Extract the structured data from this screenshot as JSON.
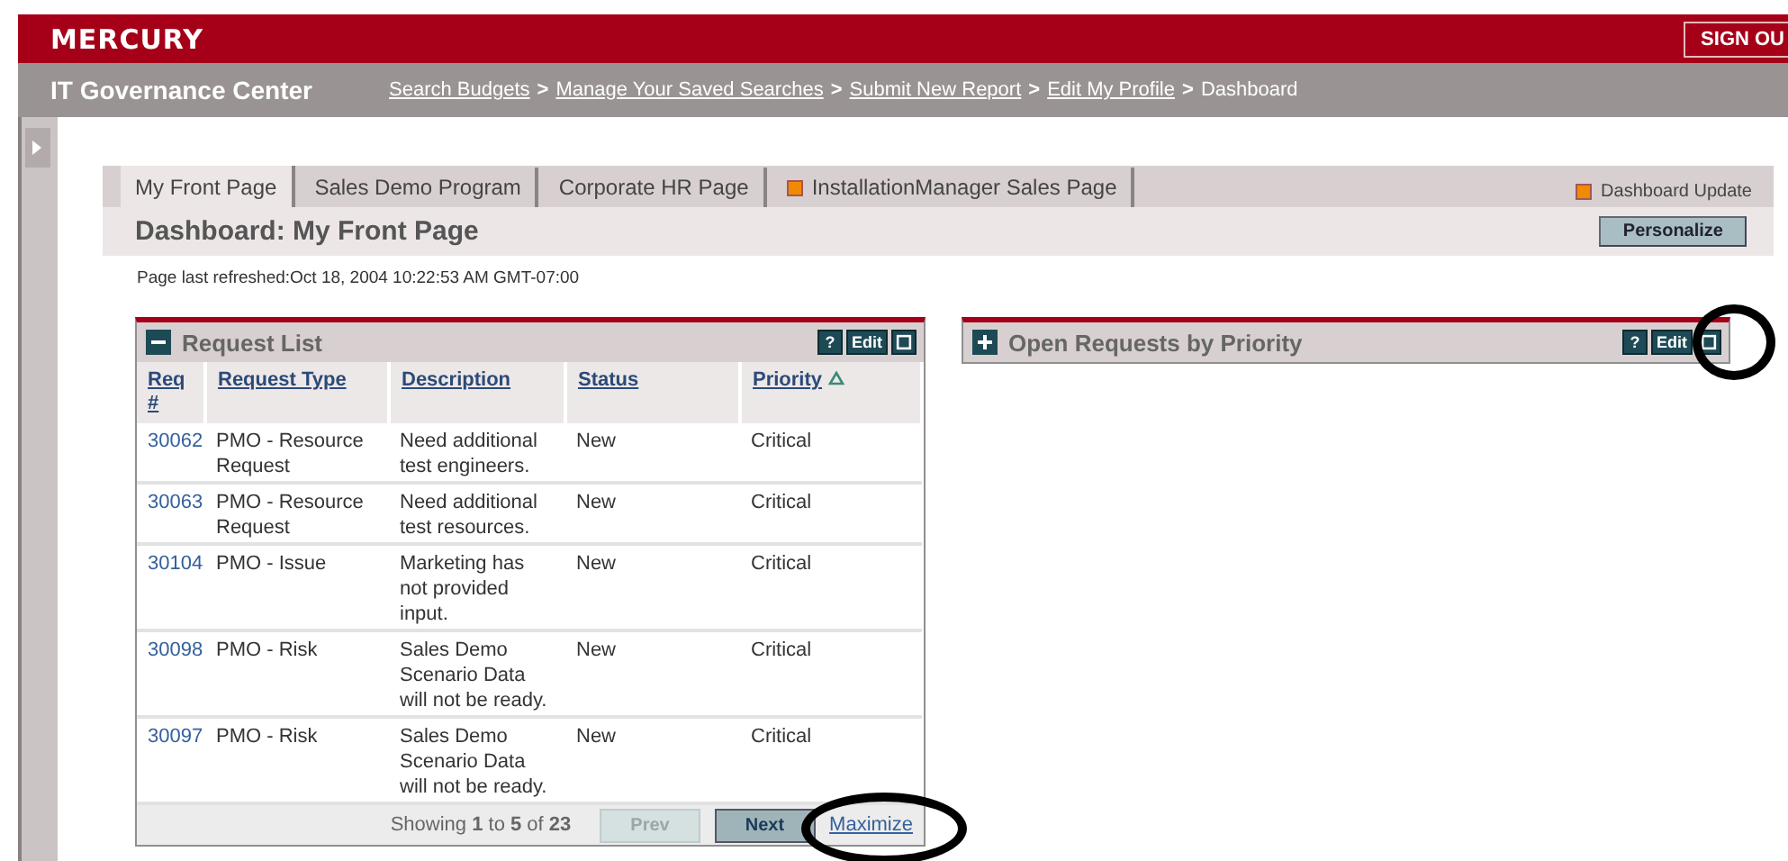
{
  "header": {
    "logo": "MERCURY",
    "sign_out": "SIGN OU"
  },
  "nav": {
    "title": "IT Governance Center",
    "separator": ">",
    "breadcrumbs": [
      {
        "label": "Search Budgets",
        "link": true
      },
      {
        "label": "Manage Your Saved Searches",
        "link": true
      },
      {
        "label": "Submit New Report",
        "link": true
      },
      {
        "label": "Edit My Profile",
        "link": true
      },
      {
        "label": "Dashboard",
        "link": false
      }
    ]
  },
  "sidebar": {
    "collapsed": true
  },
  "tabs": [
    {
      "label": "My Front Page",
      "selected": true,
      "updated": false
    },
    {
      "label": "Sales Demo Program",
      "selected": false,
      "updated": false
    },
    {
      "label": "Corporate HR Page",
      "selected": false,
      "updated": false
    },
    {
      "label": "InstallationManager Sales Page",
      "selected": false,
      "updated": true
    }
  ],
  "legend": {
    "label": "Dashboard Update"
  },
  "page_title": "Dashboard: My Front Page",
  "personalize": "Personalize",
  "refreshed": "Page last refreshed:Oct 18, 2004 10:22:53 AM GMT-07:00",
  "request_list": {
    "title": "Request List",
    "expanded": true,
    "help": "?",
    "edit": "Edit",
    "columns": [
      {
        "label": "Req #",
        "sorted": false
      },
      {
        "label": "Request Type",
        "sorted": false
      },
      {
        "label": "Description",
        "sorted": false
      },
      {
        "label": "Status",
        "sorted": false
      },
      {
        "label": "Priority",
        "sorted": true
      }
    ],
    "rows": [
      [
        "30062",
        "PMO - Resource Request",
        "Need additional test engineers.",
        "New",
        "Critical"
      ],
      [
        "30063",
        "PMO - Resource Request",
        "Need additional test resources.",
        "New",
        "Critical"
      ],
      [
        "30104",
        "PMO - Issue",
        "Marketing has not provided input.",
        "New",
        "Critical"
      ],
      [
        "30098",
        "PMO - Risk",
        "Sales Demo Scenario Data will not be ready.",
        "New",
        "Critical"
      ],
      [
        "30097",
        "PMO - Risk",
        "Sales Demo Scenario Data will not be ready.",
        "New",
        "Critical"
      ]
    ],
    "summary": "Showing **1** to **5** of **23**",
    "prev": {
      "label": "Prev",
      "disabled": true
    },
    "next": {
      "label": "Next",
      "disabled": false
    },
    "maximize": {
      "label": "Maximize",
      "circled": true
    }
  },
  "open_requests": {
    "title": "Open Requests by Priority",
    "expanded": false,
    "help": "?",
    "edit": "Edit",
    "maximize_circled": true
  }
}
